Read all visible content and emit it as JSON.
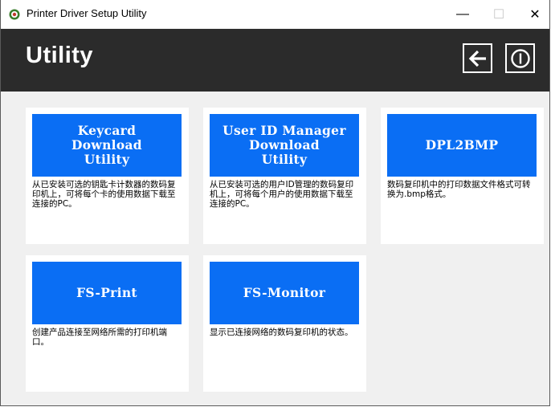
{
  "window": {
    "title": "Printer Driver Setup Utility",
    "minimize_glyph": "—",
    "maximize_glyph": "☐",
    "close_glyph": "✕"
  },
  "header": {
    "title": "Utility",
    "back_icon": "back-arrow-icon",
    "power_icon": "power-icon",
    "background": "#2b2b2b"
  },
  "colors": {
    "tile_blue": "#0a6ef4",
    "page_bg": "#f0f0f0"
  },
  "cards": [
    {
      "label": "Keycard\nDownload\nUtility",
      "description": "从已安装可选的钥匙卡计数器的数码复印机上，可将每个卡的使用数据下载至连接的PC。"
    },
    {
      "label": "User ID Manager\nDownload\nUtility",
      "description": "从已安装可选的用户ID管理的数码复印机上，可将每个用户的使用数据下载至连接的PC。"
    },
    {
      "label": "DPL2BMP",
      "description": "数码复印机中的打印数据文件格式可转换为.bmp格式。"
    },
    {
      "label": "FS-Print",
      "description": "创建产品连接至网络所需的打印机端口。"
    },
    {
      "label": "FS-Monitor",
      "description": "显示已连接网络的数码复印机的状态。"
    }
  ]
}
